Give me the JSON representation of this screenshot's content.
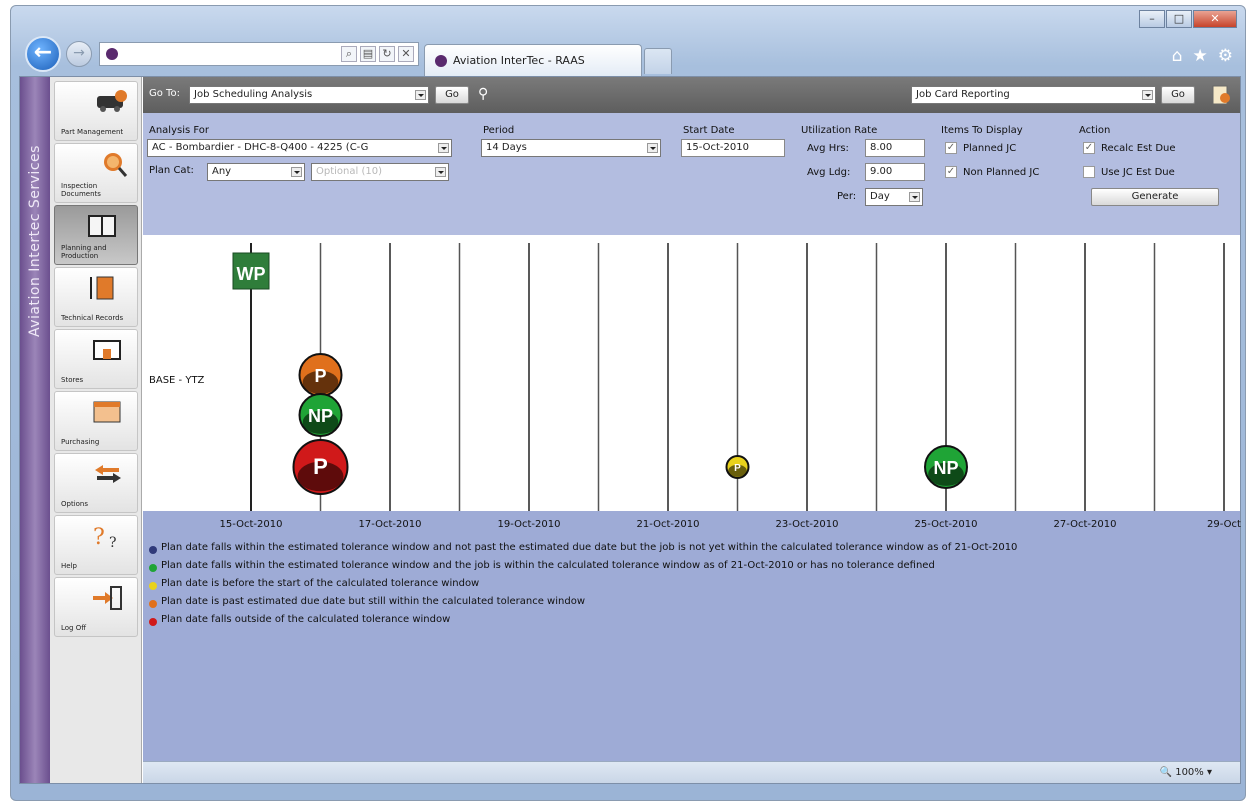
{
  "browser": {
    "tab_title": "Aviation InterTec - RAAS",
    "zoom": "100%"
  },
  "brand": {
    "text": "Aviation Intertec Services"
  },
  "sidebar": {
    "items": [
      {
        "label": "Part Management",
        "icon": "car-icon"
      },
      {
        "label": "Inspection Documents",
        "icon": "magnifier-icon"
      },
      {
        "label": "Planning and Production",
        "icon": "book-icon",
        "active": true
      },
      {
        "label": "Technical Records",
        "icon": "records-icon"
      },
      {
        "label": "Stores",
        "icon": "stores-icon"
      },
      {
        "label": "Purchasing",
        "icon": "calendar-icon"
      },
      {
        "label": "Options",
        "icon": "arrows-icon"
      },
      {
        "label": "Help",
        "icon": "help-icon"
      },
      {
        "label": "Log Off",
        "icon": "logoff-icon"
      }
    ]
  },
  "toolbar": {
    "goto_label": "Go To:",
    "goto_value": "Job Scheduling Analysis",
    "go_label": "Go",
    "report_value": "Job Card Reporting",
    "go2_label": "Go"
  },
  "form": {
    "analysis_label": "Analysis For",
    "analysis_value": "AC - Bombardier - DHC-8-Q400 - 4225 (C-G",
    "plancat_label": "Plan Cat:",
    "plancat_value": "Any",
    "optional_value": "Optional (10)",
    "period_label": "Period",
    "period_value": "14 Days",
    "start_label": "Start Date",
    "start_value": "15-Oct-2010",
    "util_label": "Utilization Rate",
    "avg_hrs_label": "Avg Hrs:",
    "avg_hrs_value": "8.00",
    "avg_ldg_label": "Avg Ldg:",
    "avg_ldg_value": "9.00",
    "per_label": "Per:",
    "per_value": "Day",
    "items_label": "Items To Display",
    "planned_label": "Planned JC",
    "nonplanned_label": "Non Planned JC",
    "action_label": "Action",
    "recalc_label": "Recalc Est Due",
    "usejc_label": "Use JC Est Due",
    "generate_label": "Generate"
  },
  "chart_data": {
    "type": "scatter",
    "row_label": "BASE - YTZ",
    "x_ticks": [
      "15-Oct-2010",
      "17-Oct-2010",
      "19-Oct-2010",
      "21-Oct-2010",
      "23-Oct-2010",
      "25-Oct-2010",
      "27-Oct-2010",
      "29-Oct"
    ],
    "markers": [
      {
        "label": "WP",
        "kind": "work-package",
        "color": "#2f7d3a",
        "x": "15-Oct-2010",
        "row": 0
      },
      {
        "label": "P",
        "color": "#e0701c",
        "x": "16-Oct-2010",
        "row": 1
      },
      {
        "label": "NP",
        "color": "#1fa436",
        "x": "16-Oct-2010",
        "row": 2
      },
      {
        "label": "P",
        "color": "#d0191a",
        "x": "16-Oct-2010",
        "row": 3,
        "big": true
      },
      {
        "label": "P",
        "color": "#e9d21c",
        "x": "22-Oct-2010",
        "row": 3,
        "small": true
      },
      {
        "label": "NP",
        "color": "#1fa436",
        "x": "25-Oct-2010",
        "row": 3
      }
    ]
  },
  "legend": [
    {
      "color": "#303a7a",
      "text": "Plan date falls within the estimated tolerance window and not past the estimated due date but the job is not yet within the calculated tolerance window as of 21-Oct-2010"
    },
    {
      "color": "#1fa436",
      "text": "Plan date falls within the estimated tolerance window and the job is within the calculated tolerance window as of 21-Oct-2010 or has no tolerance defined"
    },
    {
      "color": "#e9d21c",
      "text": "Plan date is before the start of the calculated tolerance window"
    },
    {
      "color": "#e0701c",
      "text": "Plan date is past estimated due date but still within the calculated tolerance window"
    },
    {
      "color": "#d0191a",
      "text": "Plan date falls outside of the calculated tolerance window"
    }
  ]
}
